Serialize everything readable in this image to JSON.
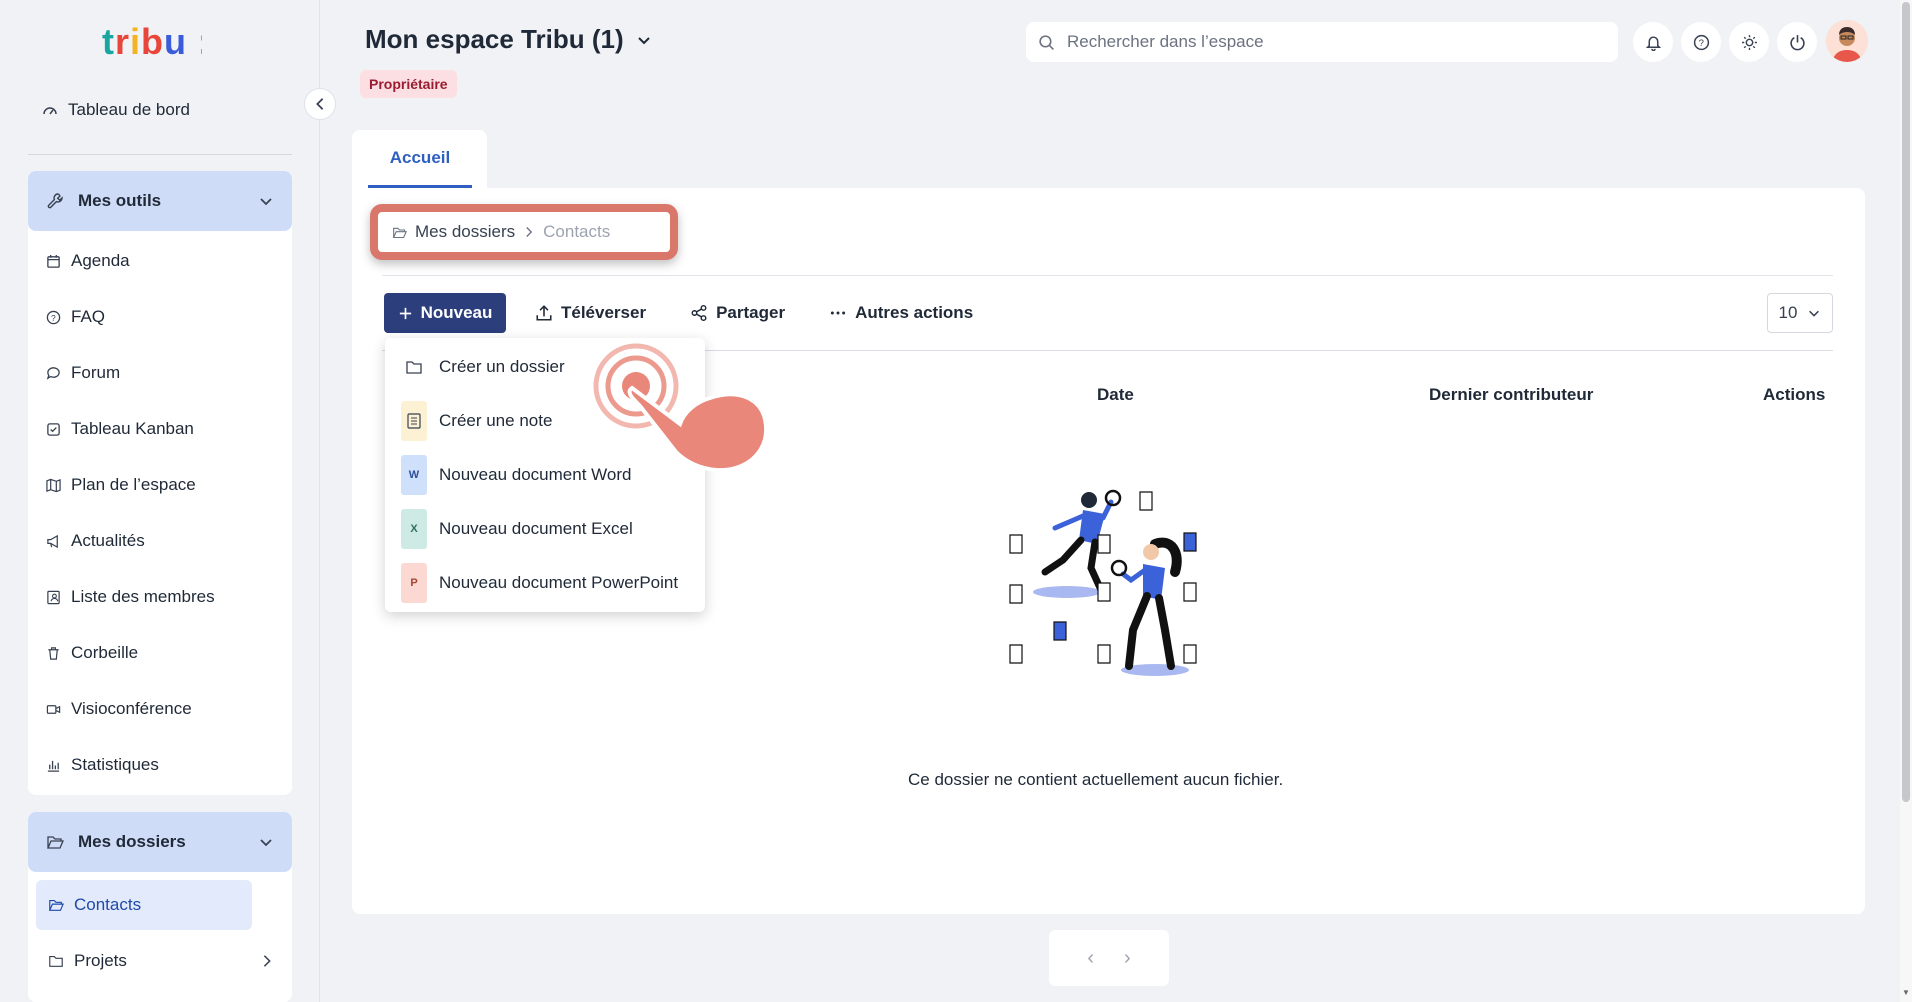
{
  "logo": {
    "text": "tribu:"
  },
  "sidebar": {
    "dashboard_label": "Tableau de bord",
    "tools": {
      "title": "Mes outils",
      "items": [
        {
          "label": "Agenda",
          "icon": "calendar-icon"
        },
        {
          "label": "FAQ",
          "icon": "help-circle-icon"
        },
        {
          "label": "Forum",
          "icon": "chat-icon"
        },
        {
          "label": "Tableau Kanban",
          "icon": "check-square-icon"
        },
        {
          "label": "Plan de l’espace",
          "icon": "map-icon"
        },
        {
          "label": "Actualités",
          "icon": "megaphone-icon"
        },
        {
          "label": "Liste des membres",
          "icon": "contact-card-icon"
        },
        {
          "label": "Corbeille",
          "icon": "trash-icon"
        },
        {
          "label": "Visioconférence",
          "icon": "video-icon"
        },
        {
          "label": "Statistiques",
          "icon": "bar-chart-icon"
        }
      ]
    },
    "folders": {
      "title": "Mes dossiers",
      "items": [
        {
          "label": "Contacts",
          "active": true
        },
        {
          "label": "Projets",
          "active": false
        }
      ]
    }
  },
  "header": {
    "space_title": "Mon espace Tribu (1)",
    "role_badge": "Propriétaire",
    "search_placeholder": "Rechercher dans l’espace"
  },
  "tabs": [
    {
      "label": "Accueil",
      "active": true
    }
  ],
  "breadcrumb": {
    "root": "Mes dossiers",
    "current": "Contacts"
  },
  "toolbar": {
    "new_label": "Nouveau",
    "upload_label": "Téléverser",
    "share_label": "Partager",
    "more_label": "Autres actions",
    "page_size": "10"
  },
  "new_menu": [
    {
      "label": "Créer un dossier",
      "icon": "folder-icon"
    },
    {
      "label": "Créer une note",
      "icon": "note-icon"
    },
    {
      "label": "Nouveau document Word",
      "icon": "word-icon",
      "letter": "W"
    },
    {
      "label": "Nouveau document Excel",
      "icon": "excel-icon",
      "letter": "X"
    },
    {
      "label": "Nouveau document PowerPoint",
      "icon": "powerpoint-icon",
      "letter": "P"
    }
  ],
  "table": {
    "columns": [
      "Date",
      "Dernier contributeur",
      "Actions"
    ],
    "empty_message": "Ce dossier ne contient actuellement aucun fichier."
  },
  "pager": {
    "prev": "‹",
    "next": "›"
  },
  "colors": {
    "primary": "#2c3e7b",
    "accent": "#2f5fc1",
    "sidebar_head": "#cfdcf7",
    "badge_bg": "#fcdfe3",
    "highlight": "#d9786a"
  }
}
